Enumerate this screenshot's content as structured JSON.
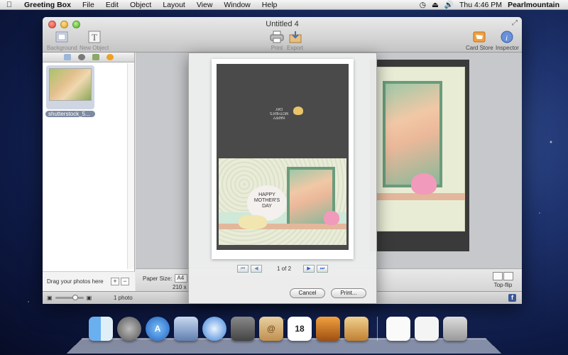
{
  "menubar": {
    "app_name": "Greeting Box",
    "items": [
      "File",
      "Edit",
      "Object",
      "Layout",
      "View",
      "Window",
      "Help"
    ],
    "clock": "Thu 4:46 PM",
    "user": "Pearlmountain"
  },
  "window": {
    "title": "Untitled 4",
    "toolbar": {
      "background_label": "Background",
      "new_object_label": "New Object",
      "print_label": "Print",
      "export_label": "Export",
      "card_store_label": "Card Store",
      "inspector_label": "Inspector"
    }
  },
  "left_panel": {
    "photo_label": "shutterstock_5...",
    "drag_hint": "Drag your photos here",
    "add_label": "+",
    "remove_label": "−"
  },
  "statusbar": {
    "paper_size_label": "Paper Size:",
    "paper_size_value": "A4",
    "dimensions_text": "210 x",
    "flip_label": "Top-flip"
  },
  "bottombar": {
    "photo_count": "1 photo",
    "facebook_label": "f"
  },
  "print_sheet": {
    "card_text": [
      "HAPPY",
      "MOTHER'S",
      "DAY"
    ],
    "page_indicator": "1 of 2",
    "cancel_label": "Cancel",
    "print_label": "Print..."
  },
  "colors": {
    "accent_blue": "#2a5fd0",
    "card_dark": "#4a4a4a",
    "card_mint": "#cfe8d8",
    "card_pink": "#f29abb"
  }
}
